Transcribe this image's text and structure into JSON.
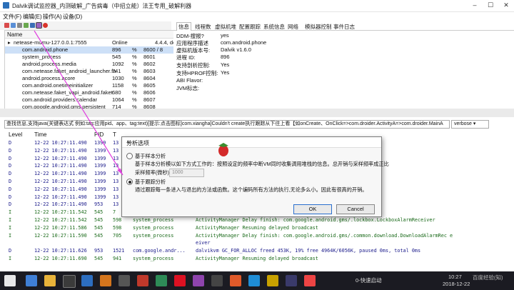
{
  "window": {
    "title": "Dalvik调试监控器_内测破解_广告病毒（中招立能）法王专用_破解利器"
  },
  "menu": [
    "文件(F)",
    "编辑(E)",
    "操作(A)",
    "设备(D)"
  ],
  "devices": {
    "header": {
      "name": "Name"
    },
    "rows": [
      {
        "name": "netease-mumu-127.0.0.1:7555",
        "col2": "Online",
        "col3": "",
        "col4": "4.4.4, del"
      },
      {
        "name": "com.android.phone",
        "col2": "896",
        "col3": "%",
        "col4": "8600 / 8"
      },
      {
        "name": "system_process",
        "col2": "545",
        "col3": "%",
        "col4": "8601"
      },
      {
        "name": "android.process.media",
        "col2": "1092",
        "col3": "%",
        "col4": "8602"
      },
      {
        "name": "com.netease.faket_android_launcher.fa",
        "col2": "741",
        "col3": "%",
        "col4": "8603"
      },
      {
        "name": "android.process.acore",
        "col2": "1030",
        "col3": "%",
        "col4": "8604"
      },
      {
        "name": "com.android.onetimeinitializer",
        "col2": "1158",
        "col3": "%",
        "col4": "8605"
      },
      {
        "name": "com.netease.faket_vapi_android.faket",
        "col2": "680",
        "col3": "%",
        "col4": "8606"
      },
      {
        "name": "com.android.providers.calendar",
        "col2": "1064",
        "col3": "%",
        "col4": "8607"
      },
      {
        "name": "com.google.android.gms.persistent",
        "col2": "714",
        "col3": "%",
        "col4": "8608"
      }
    ]
  },
  "tabs": [
    "信息",
    "线程数",
    "虚拟机堆",
    "配置跟踪",
    "系统信息",
    "网络",
    "模拟器控制",
    "事件日志"
  ],
  "info": [
    {
      "k": "DDM-搜报?",
      "v": "yes"
    },
    {
      "k": "应用程序描述",
      "v": "com.android.phone"
    },
    {
      "k": "虚拟机版本号:",
      "v": "Dalvik v1.6.0"
    },
    {
      "k": "进程 ID:",
      "v": "896"
    },
    {
      "k": "支持剖析控制:",
      "v": "Yes"
    },
    {
      "k": "支持HPROF控制:",
      "v": "Yes"
    },
    {
      "k": "ABI Flavor:",
      "v": ""
    },
    {
      "k": "JVM标志:",
      "v": ""
    }
  ],
  "filter": {
    "value": "查找信息,支持java(关键表达式 例如:tag:应用pid、app、tag:text)[提示:点击图标]com.xiangha]Couldn't create执行跟踪从下往上看【如onCreate、OnClick=>com.droider.ActivityA=>com.droider.MainA",
    "level": "verbose"
  },
  "log": {
    "headers": [
      "Level",
      "Time",
      "PID",
      "T"
    ],
    "rows": [
      {
        "level": "D",
        "time": "12-22 10:27:11.490",
        "pid": "1399",
        "tid": "13",
        "tag": "",
        "text": ""
      },
      {
        "level": "D",
        "time": "12-22 10:27:11.490",
        "pid": "1399",
        "tid": "13",
        "tag": "",
        "text": ""
      },
      {
        "level": "D",
        "time": "12-22 10:27:11.490",
        "pid": "1399",
        "tid": "13",
        "tag": "",
        "text": ""
      },
      {
        "level": "D",
        "time": "12-22 10:27:11.490",
        "pid": "1399",
        "tid": "13",
        "tag": "",
        "text": ""
      },
      {
        "level": "D",
        "time": "12-22 10:27:11.490",
        "pid": "1399",
        "tid": "13",
        "tag": "",
        "text": ""
      },
      {
        "level": "D",
        "time": "12-22 10:27:11.490",
        "pid": "1399",
        "tid": "13",
        "tag": "",
        "text": ""
      },
      {
        "level": "D",
        "time": "12-22 10:27:11.490",
        "pid": "1399",
        "tid": "13",
        "tag": "",
        "text": ""
      },
      {
        "level": "D",
        "time": "12-22 10:27:11.490",
        "pid": "1399",
        "tid": "13",
        "tag": "",
        "text": ""
      },
      {
        "level": "D",
        "time": "12-22 10:27:11.490",
        "pid": "953",
        "tid": "13",
        "tag": "",
        "text": ""
      },
      {
        "level": "I",
        "time": "12-22 10:27:11.542",
        "pid": "545",
        "tid": "7",
        "tag": "",
        "text": ""
      },
      {
        "level": "I",
        "time": "12-22 10:27:11.542",
        "pid": "545",
        "tid": "598",
        "tag": "system_process",
        "text": "ActivityManager    Delay finish: com.google.android.gms/.lockbox.LockboxAlarmReceiver"
      },
      {
        "level": "I",
        "time": "12-22 10:27:11.586",
        "pid": "545",
        "tid": "598",
        "tag": "system_process",
        "text": "ActivityManager    Resuming delayed broadcast"
      },
      {
        "level": "I",
        "time": "12-22 10:27:11.590",
        "pid": "545",
        "tid": "705",
        "tag": "system_process",
        "text": "ActivityManager    Delay finish: com.google.android.gms/.common.download.DownloadAlarmRec e"
      },
      {
        "level": "",
        "time": "",
        "pid": "",
        "tid": "",
        "tag": "",
        "text": "                                      eiver"
      },
      {
        "level": "D",
        "time": "12-22 10:27:11.626",
        "pid": "953",
        "tid": "1521",
        "tag": "com.google.andr...",
        "text": "dalvikvm          GC_FOR_ALLOC freed 453K, 19% free 4964K/6056K, paused 0ms, total 0ms"
      },
      {
        "level": "I",
        "time": "12-22 10:27:11.690",
        "pid": "545",
        "tid": "941",
        "tag": "system_process",
        "text": "ActivityManager    Resuming delayed broadcast"
      }
    ]
  },
  "dialog": {
    "title": "分析选项",
    "opt1_label": "基于样本分析",
    "opt1_desc": "基于样本分析模以如下方式工作的：按照设定的频率中断VM同时收集调用堆栈的信息。总开销与采样频率成正比",
    "sampling_label": "采样频率(微秒)：",
    "sampling_value": "1000",
    "opt2_label": "基于跟踪分析",
    "opt2_desc": "通过跟踪每一条进入与退出的方法或函数。这个编码所有方法的执行,无论多么小。因此有很高的开销。",
    "ok": "OK",
    "cancel": "Cancel",
    "selected": "opt2"
  },
  "taskbar": {
    "tray_left": "0-快速启动",
    "time": "10:27",
    "date": "2018-12-22",
    "brand": "百度经验(知)"
  },
  "colors": {
    "selection": "#cde0f7",
    "accent": "#2a6fcf",
    "arrow": "#e040e0",
    "taskbar": "#1b1b22"
  }
}
